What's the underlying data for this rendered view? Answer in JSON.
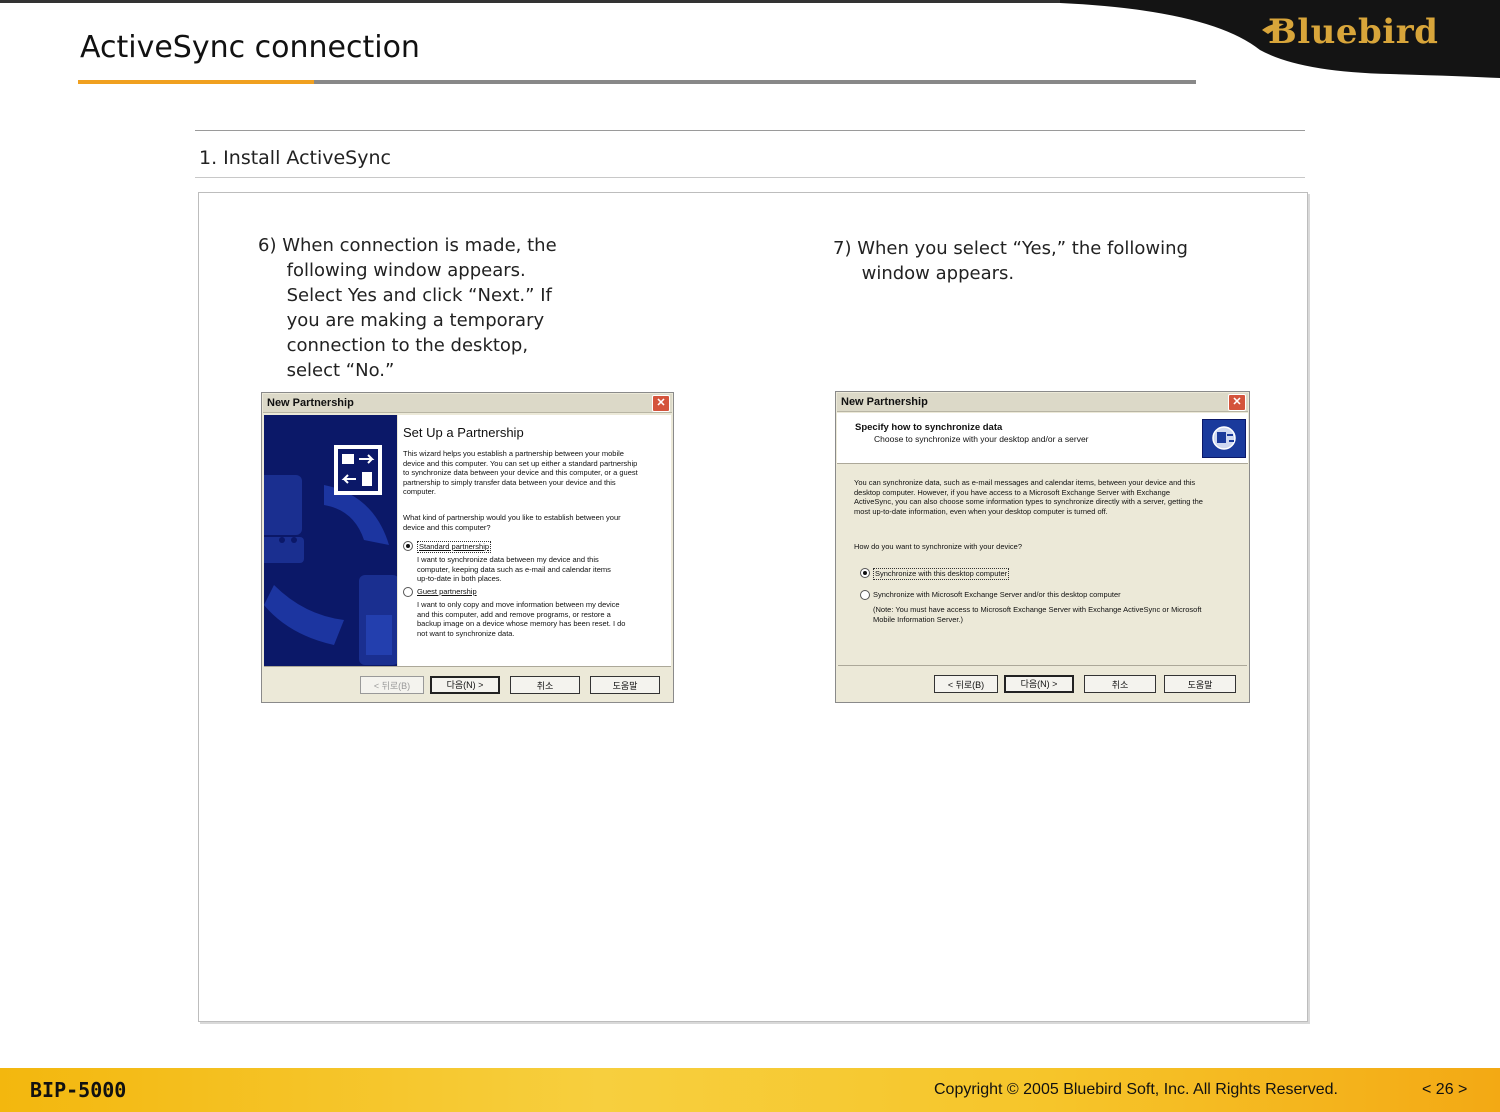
{
  "header": {
    "title": "ActiveSync connection",
    "logo_text": "Bluebird"
  },
  "section": {
    "title": "1. Install ActiveSync"
  },
  "steps": {
    "step6": "6) When connection is made, the\n     following window appears.\n     Select Yes and click “Next.” If\n     you are making a temporary\n     connection to the desktop,\n     select “No.”",
    "step7": "7) When you select “Yes,” the following\n     window appears."
  },
  "dialog1": {
    "title": "New Partnership",
    "heading": "Set Up a Partnership",
    "intro": "This wizard helps you establish a partnership between your mobile device and this computer.  You can set up either a standard partnership to synchronize data between your device and this computer, or a guest partnership to simply transfer data between your device and this computer.",
    "question": "What kind of partnership would you like to establish between your device and this computer?",
    "option1_label": "Standard partnership",
    "option1_desc": "I want to synchronize data between my device and this computer, keeping data such as e-mail and calendar items up-to-date in both places.",
    "option2_label": "Guest partnership",
    "option2_desc": "I want to only copy and move information between my device and this computer, add and remove programs, or restore a backup image on a device whose memory has been reset. I do not want to synchronize data.",
    "buttons": {
      "back": "< 뒤로(B)",
      "next": "다음(N) >",
      "cancel": "취소",
      "help": "도움말"
    }
  },
  "dialog2": {
    "title": "New Partnership",
    "heading": "Specify how to synchronize data",
    "subheading": "Choose to synchronize with your desktop and/or a server",
    "body": "You can synchronize data, such as e-mail messages and calendar items, between your device and this desktop computer.  However, if you have access to a Microsoft Exchange Server with Exchange ActiveSync, you can also choose some information types to synchronize directly with a server, getting the most up-to-date information, even when your desktop computer is turned off.",
    "question": "How do you want to synchronize with your device?",
    "option1_label": "Synchronize with this desktop computer",
    "option2_label": "Synchronize with Microsoft Exchange Server and/or this desktop computer",
    "option2_note": "(Note: You must have access to Microsoft Exchange Server with Exchange ActiveSync or Microsoft Mobile Information Server.)",
    "buttons": {
      "back": "< 뒤로(B)",
      "next": "다음(N) >",
      "cancel": "취소",
      "help": "도움말"
    }
  },
  "footer": {
    "model": "BIP-5000",
    "copyright": "Copyright © 2005 Bluebird Soft, Inc. All Rights Reserved.",
    "page": "< 26 >"
  },
  "colors": {
    "accent_orange": "#f0a020",
    "footer_yellow": "#f6c52a",
    "logo_gold": "#d8a53a",
    "wizard_navy": "#0b1868"
  }
}
